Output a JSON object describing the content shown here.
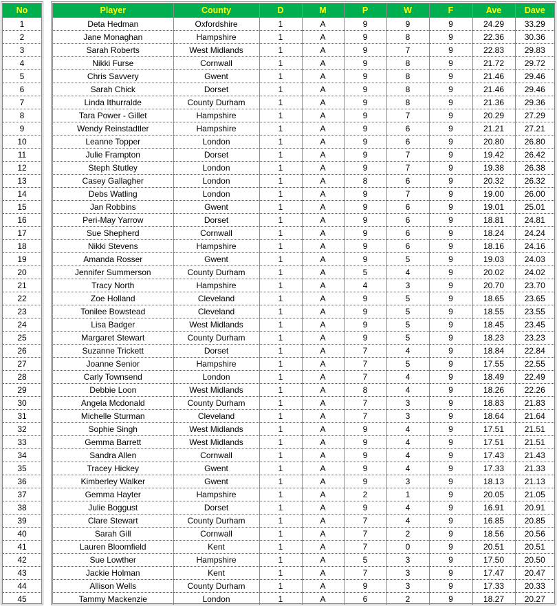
{
  "headers": {
    "no": "No",
    "player": "Player",
    "county": "County",
    "d": "D",
    "m": "M",
    "p": "P",
    "w": "W",
    "f": "F",
    "ave": "Ave",
    "dave": "Dave"
  },
  "colors": {
    "header_bg": "#00b050",
    "header_text": "#ffff00"
  },
  "rows": [
    {
      "no": "1",
      "player": "Deta Hedman",
      "county": "Oxfordshire",
      "d": "1",
      "m": "A",
      "p": "9",
      "w": "9",
      "f": "9",
      "ave": "24.29",
      "dave": "33.29"
    },
    {
      "no": "2",
      "player": "Jane Monaghan",
      "county": "Hampshire",
      "d": "1",
      "m": "A",
      "p": "9",
      "w": "8",
      "f": "9",
      "ave": "22.36",
      "dave": "30.36"
    },
    {
      "no": "3",
      "player": "Sarah Roberts",
      "county": "West Midlands",
      "d": "1",
      "m": "A",
      "p": "9",
      "w": "7",
      "f": "9",
      "ave": "22.83",
      "dave": "29.83"
    },
    {
      "no": "4",
      "player": "Nikki Furse",
      "county": "Cornwall",
      "d": "1",
      "m": "A",
      "p": "9",
      "w": "8",
      "f": "9",
      "ave": "21.72",
      "dave": "29.72"
    },
    {
      "no": "5",
      "player": "Chris Savvery",
      "county": "Gwent",
      "d": "1",
      "m": "A",
      "p": "9",
      "w": "8",
      "f": "9",
      "ave": "21.46",
      "dave": "29.46"
    },
    {
      "no": "6",
      "player": "Sarah Chick",
      "county": "Dorset",
      "d": "1",
      "m": "A",
      "p": "9",
      "w": "8",
      "f": "9",
      "ave": "21.46",
      "dave": "29.46"
    },
    {
      "no": "7",
      "player": "Linda Ithurralde",
      "county": "County Durham",
      "d": "1",
      "m": "A",
      "p": "9",
      "w": "8",
      "f": "9",
      "ave": "21.36",
      "dave": "29.36"
    },
    {
      "no": "8",
      "player": "Tara Power - Gillet",
      "county": "Hampshire",
      "d": "1",
      "m": "A",
      "p": "9",
      "w": "7",
      "f": "9",
      "ave": "20.29",
      "dave": "27.29"
    },
    {
      "no": "9",
      "player": "Wendy Reinstadtler",
      "county": "Hampshire",
      "d": "1",
      "m": "A",
      "p": "9",
      "w": "6",
      "f": "9",
      "ave": "21.21",
      "dave": "27.21"
    },
    {
      "no": "10",
      "player": "Leanne Topper",
      "county": "London",
      "d": "1",
      "m": "A",
      "p": "9",
      "w": "6",
      "f": "9",
      "ave": "20.80",
      "dave": "26.80"
    },
    {
      "no": "11",
      "player": "Julie Frampton",
      "county": "Dorset",
      "d": "1",
      "m": "A",
      "p": "9",
      "w": "7",
      "f": "9",
      "ave": "19.42",
      "dave": "26.42"
    },
    {
      "no": "12",
      "player": "Steph Stutley",
      "county": "London",
      "d": "1",
      "m": "A",
      "p": "9",
      "w": "7",
      "f": "9",
      "ave": "19.38",
      "dave": "26.38"
    },
    {
      "no": "13",
      "player": "Casey Gallagher",
      "county": "London",
      "d": "1",
      "m": "A",
      "p": "8",
      "w": "6",
      "f": "9",
      "ave": "20.32",
      "dave": "26.32"
    },
    {
      "no": "14",
      "player": "Debs Watling",
      "county": "London",
      "d": "1",
      "m": "A",
      "p": "9",
      "w": "7",
      "f": "9",
      "ave": "19.00",
      "dave": "26.00"
    },
    {
      "no": "15",
      "player": "Jan Robbins",
      "county": "Gwent",
      "d": "1",
      "m": "A",
      "p": "9",
      "w": "6",
      "f": "9",
      "ave": "19.01",
      "dave": "25.01"
    },
    {
      "no": "16",
      "player": "Peri-May Yarrow",
      "county": "Dorset",
      "d": "1",
      "m": "A",
      "p": "9",
      "w": "6",
      "f": "9",
      "ave": "18.81",
      "dave": "24.81"
    },
    {
      "no": "17",
      "player": "Sue Shepherd",
      "county": "Cornwall",
      "d": "1",
      "m": "A",
      "p": "9",
      "w": "6",
      "f": "9",
      "ave": "18.24",
      "dave": "24.24"
    },
    {
      "no": "18",
      "player": "Nikki Stevens",
      "county": "Hampshire",
      "d": "1",
      "m": "A",
      "p": "9",
      "w": "6",
      "f": "9",
      "ave": "18.16",
      "dave": "24.16"
    },
    {
      "no": "19",
      "player": "Amanda Rosser",
      "county": "Gwent",
      "d": "1",
      "m": "A",
      "p": "9",
      "w": "5",
      "f": "9",
      "ave": "19.03",
      "dave": "24.03"
    },
    {
      "no": "20",
      "player": "Jennifer Summerson",
      "county": "County Durham",
      "d": "1",
      "m": "A",
      "p": "5",
      "w": "4",
      "f": "9",
      "ave": "20.02",
      "dave": "24.02"
    },
    {
      "no": "21",
      "player": "Tracy North",
      "county": "Hampshire",
      "d": "1",
      "m": "A",
      "p": "4",
      "w": "3",
      "f": "9",
      "ave": "20.70",
      "dave": "23.70"
    },
    {
      "no": "22",
      "player": "Zoe Holland",
      "county": "Cleveland",
      "d": "1",
      "m": "A",
      "p": "9",
      "w": "5",
      "f": "9",
      "ave": "18.65",
      "dave": "23.65"
    },
    {
      "no": "23",
      "player": "Tonilee Bowstead",
      "county": "Cleveland",
      "d": "1",
      "m": "A",
      "p": "9",
      "w": "5",
      "f": "9",
      "ave": "18.55",
      "dave": "23.55"
    },
    {
      "no": "24",
      "player": "Lisa Badger",
      "county": "West Midlands",
      "d": "1",
      "m": "A",
      "p": "9",
      "w": "5",
      "f": "9",
      "ave": "18.45",
      "dave": "23.45"
    },
    {
      "no": "25",
      "player": "Margaret Stewart",
      "county": "County Durham",
      "d": "1",
      "m": "A",
      "p": "9",
      "w": "5",
      "f": "9",
      "ave": "18.23",
      "dave": "23.23"
    },
    {
      "no": "26",
      "player": "Suzanne Trickett",
      "county": "Dorset",
      "d": "1",
      "m": "A",
      "p": "7",
      "w": "4",
      "f": "9",
      "ave": "18.84",
      "dave": "22.84"
    },
    {
      "no": "27",
      "player": "Joanne Senior",
      "county": "Hampshire",
      "d": "1",
      "m": "A",
      "p": "7",
      "w": "5",
      "f": "9",
      "ave": "17.55",
      "dave": "22.55"
    },
    {
      "no": "28",
      "player": "Carly Townsend",
      "county": "London",
      "d": "1",
      "m": "A",
      "p": "7",
      "w": "4",
      "f": "9",
      "ave": "18.49",
      "dave": "22.49"
    },
    {
      "no": "29",
      "player": "Debbie Loon",
      "county": "West Midlands",
      "d": "1",
      "m": "A",
      "p": "8",
      "w": "4",
      "f": "9",
      "ave": "18.26",
      "dave": "22.26"
    },
    {
      "no": "30",
      "player": "Angela Mcdonald",
      "county": "County Durham",
      "d": "1",
      "m": "A",
      "p": "7",
      "w": "3",
      "f": "9",
      "ave": "18.83",
      "dave": "21.83"
    },
    {
      "no": "31",
      "player": "Michelle Sturman",
      "county": "Cleveland",
      "d": "1",
      "m": "A",
      "p": "7",
      "w": "3",
      "f": "9",
      "ave": "18.64",
      "dave": "21.64"
    },
    {
      "no": "32",
      "player": "Sophie Singh",
      "county": "West Midlands",
      "d": "1",
      "m": "A",
      "p": "9",
      "w": "4",
      "f": "9",
      "ave": "17.51",
      "dave": "21.51"
    },
    {
      "no": "33",
      "player": "Gemma Barrett",
      "county": "West Midlands",
      "d": "1",
      "m": "A",
      "p": "9",
      "w": "4",
      "f": "9",
      "ave": "17.51",
      "dave": "21.51"
    },
    {
      "no": "34",
      "player": "Sandra Allen",
      "county": "Cornwall",
      "d": "1",
      "m": "A",
      "p": "9",
      "w": "4",
      "f": "9",
      "ave": "17.43",
      "dave": "21.43"
    },
    {
      "no": "35",
      "player": "Tracey Hickey",
      "county": "Gwent",
      "d": "1",
      "m": "A",
      "p": "9",
      "w": "4",
      "f": "9",
      "ave": "17.33",
      "dave": "21.33"
    },
    {
      "no": "36",
      "player": "Kimberley Walker",
      "county": "Gwent",
      "d": "1",
      "m": "A",
      "p": "9",
      "w": "3",
      "f": "9",
      "ave": "18.13",
      "dave": "21.13"
    },
    {
      "no": "37",
      "player": "Gemma Hayter",
      "county": "Hampshire",
      "d": "1",
      "m": "A",
      "p": "2",
      "w": "1",
      "f": "9",
      "ave": "20.05",
      "dave": "21.05"
    },
    {
      "no": "38",
      "player": "Julie Boggust",
      "county": "Dorset",
      "d": "1",
      "m": "A",
      "p": "9",
      "w": "4",
      "f": "9",
      "ave": "16.91",
      "dave": "20.91"
    },
    {
      "no": "39",
      "player": "Clare Stewart",
      "county": "County Durham",
      "d": "1",
      "m": "A",
      "p": "7",
      "w": "4",
      "f": "9",
      "ave": "16.85",
      "dave": "20.85"
    },
    {
      "no": "40",
      "player": "Sarah Gill",
      "county": "Cornwall",
      "d": "1",
      "m": "A",
      "p": "7",
      "w": "2",
      "f": "9",
      "ave": "18.56",
      "dave": "20.56"
    },
    {
      "no": "41",
      "player": "Lauren Bloomfield",
      "county": "Kent",
      "d": "1",
      "m": "A",
      "p": "7",
      "w": "0",
      "f": "9",
      "ave": "20.51",
      "dave": "20.51"
    },
    {
      "no": "42",
      "player": "Sue Lowther",
      "county": "Hampshire",
      "d": "1",
      "m": "A",
      "p": "5",
      "w": "3",
      "f": "9",
      "ave": "17.50",
      "dave": "20.50"
    },
    {
      "no": "43",
      "player": "Jackie Holman",
      "county": "Kent",
      "d": "1",
      "m": "A",
      "p": "7",
      "w": "3",
      "f": "9",
      "ave": "17.47",
      "dave": "20.47"
    },
    {
      "no": "44",
      "player": "Allison Wells",
      "county": "County Durham",
      "d": "1",
      "m": "A",
      "p": "9",
      "w": "3",
      "f": "9",
      "ave": "17.33",
      "dave": "20.33"
    },
    {
      "no": "45",
      "player": "Tammy Mackenzie",
      "county": "London",
      "d": "1",
      "m": "A",
      "p": "6",
      "w": "2",
      "f": "9",
      "ave": "18.27",
      "dave": "20.27"
    }
  ]
}
